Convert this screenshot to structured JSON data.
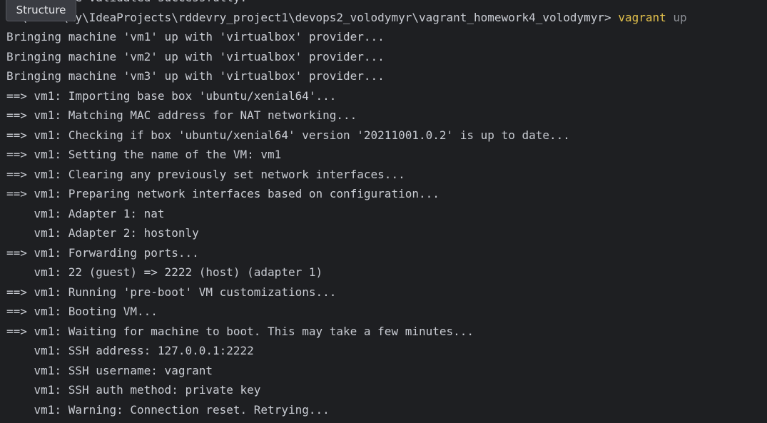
{
  "overlay": {
    "structure_label": "Structure"
  },
  "terminal": {
    "partial_top_line": "Vagrantfile validated successfully.",
    "prompt_path": "C:\\Users\\Ry\\IdeaProjects\\rddevry_project1\\devops2_volodymyr\\vagrant_homework4_volodymyr> ",
    "command": "vagrant",
    "command_arg": "up",
    "lines": [
      "Bringing machine 'vm1' up with 'virtualbox' provider...",
      "Bringing machine 'vm2' up with 'virtualbox' provider...",
      "Bringing machine 'vm3' up with 'virtualbox' provider...",
      "==> vm1: Importing base box 'ubuntu/xenial64'...",
      "==> vm1: Matching MAC address for NAT networking...",
      "==> vm1: Checking if box 'ubuntu/xenial64' version '20211001.0.2' is up to date...",
      "==> vm1: Setting the name of the VM: vm1",
      "==> vm1: Clearing any previously set network interfaces...",
      "==> vm1: Preparing network interfaces based on configuration...",
      "    vm1: Adapter 1: nat",
      "    vm1: Adapter 2: hostonly",
      "==> vm1: Forwarding ports...",
      "    vm1: 22 (guest) => 2222 (host) (adapter 1)",
      "==> vm1: Running 'pre-boot' VM customizations...",
      "==> vm1: Booting VM...",
      "==> vm1: Waiting for machine to boot. This may take a few minutes...",
      "    vm1: SSH address: 127.0.0.1:2222",
      "    vm1: SSH username: vagrant",
      "    vm1: SSH auth method: private key",
      "    vm1: Warning: Connection reset. Retrying..."
    ]
  },
  "colors": {
    "background": "#1e1f22",
    "text": "#c9ccd3",
    "command": "#e2c04c",
    "command_arg": "#8c8f96"
  }
}
